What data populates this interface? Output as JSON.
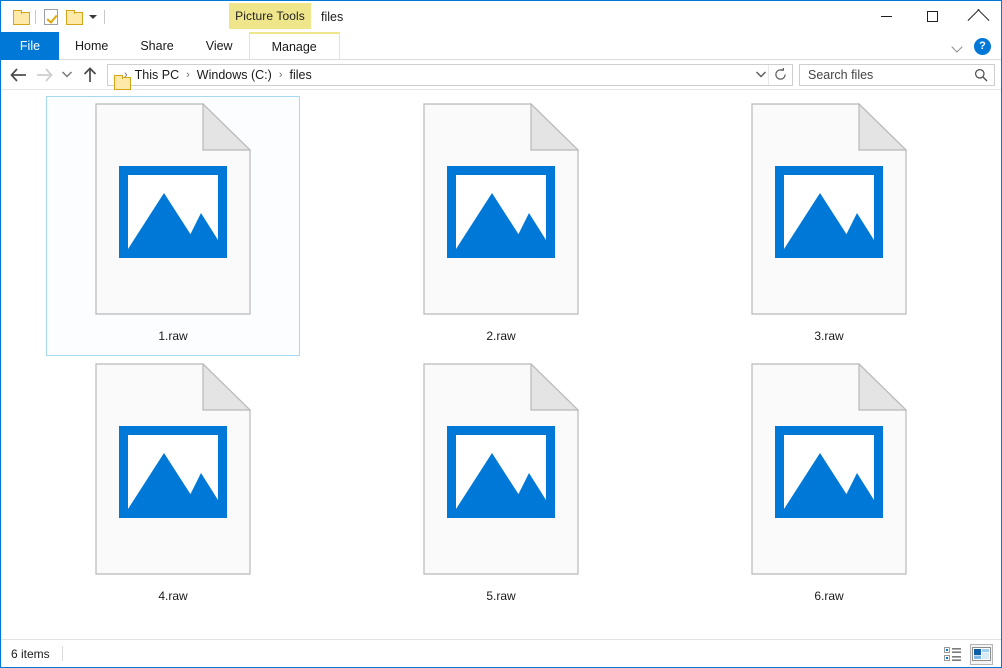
{
  "window": {
    "title": "files",
    "contextual_tab_group": "Picture Tools",
    "controls": {
      "minimize": "Minimize",
      "maximize": "Maximize",
      "close": "Close"
    }
  },
  "quick_access_toolbar": {
    "items": [
      {
        "name": "new-folder",
        "icon": "folder-icon",
        "label": "New folder"
      },
      {
        "name": "properties",
        "icon": "properties-icon",
        "label": "Properties"
      },
      {
        "name": "open-folder",
        "icon": "folder-icon",
        "label": "Open"
      },
      {
        "name": "customize",
        "icon": "chevron-down-icon",
        "label": "Customize Quick Access Toolbar"
      }
    ]
  },
  "ribbon": {
    "tabs": [
      {
        "label": "File",
        "active": true
      },
      {
        "label": "Home",
        "active": false
      },
      {
        "label": "Share",
        "active": false
      },
      {
        "label": "View",
        "active": false
      },
      {
        "label": "Manage",
        "active": false,
        "contextual": true
      }
    ],
    "collapse_label": "Minimize the Ribbon",
    "help_label": "?"
  },
  "navigation": {
    "back": "Back",
    "forward": "Forward",
    "recent": "Recent locations",
    "up": "Up"
  },
  "breadcrumb": {
    "folder_icon": "folder-icon",
    "separator": "›",
    "segments": [
      "This PC",
      "Windows (C:)",
      "files"
    ],
    "dropdown_label": "Previous locations",
    "refresh_label": "Refresh"
  },
  "search": {
    "placeholder": "Search files",
    "value": "",
    "icon": "search-icon"
  },
  "files": [
    {
      "name": "1.raw",
      "icon": "picture-file-icon",
      "selected": true
    },
    {
      "name": "2.raw",
      "icon": "picture-file-icon",
      "selected": false
    },
    {
      "name": "3.raw",
      "icon": "picture-file-icon",
      "selected": false
    },
    {
      "name": "4.raw",
      "icon": "picture-file-icon",
      "selected": false
    },
    {
      "name": "5.raw",
      "icon": "picture-file-icon",
      "selected": false
    },
    {
      "name": "6.raw",
      "icon": "picture-file-icon",
      "selected": false
    }
  ],
  "status": {
    "item_count": "6 items",
    "views": [
      {
        "name": "details-view",
        "label": "Details view",
        "active": false
      },
      {
        "name": "large-icons-view",
        "label": "Large icons view",
        "active": true
      }
    ]
  },
  "colors": {
    "accent": "#0078d7",
    "contextual_tab": "#efe58a",
    "selection_border": "#a6d8f2",
    "window_border": "#0078d7"
  }
}
